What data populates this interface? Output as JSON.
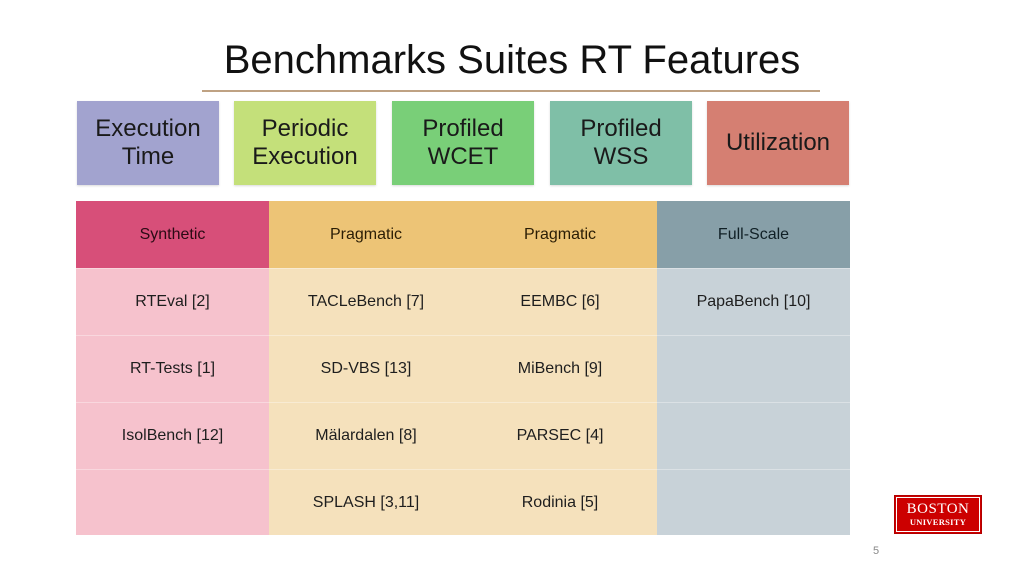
{
  "slide": {
    "title": "Benchmarks Suites RT Features",
    "page_number": "5"
  },
  "features": [
    {
      "label": "Execution Time",
      "color": "#a2a3cf"
    },
    {
      "label": "Periodic Execution",
      "color": "#c4e07a"
    },
    {
      "label": "Profiled WCET",
      "color": "#79cf78"
    },
    {
      "label": "Profiled WSS",
      "color": "#7fbfa7"
    },
    {
      "label": "Utilization",
      "color": "#d57f72"
    }
  ],
  "table": {
    "headers": [
      "Synthetic",
      "Pragmatic",
      "Pragmatic",
      "Full-Scale"
    ],
    "rows": [
      [
        "RTEval [2]",
        "TACLeBench [7]",
        "EEMBC [6]",
        "PapaBench [10]"
      ],
      [
        "RT-Tests [1]",
        "SD-VBS [13]",
        "MiBench [9]",
        ""
      ],
      [
        "IsolBench [12]",
        "Mälardalen [8]",
        "PARSEC [4]",
        ""
      ],
      [
        "",
        "SPLASH [3,11]",
        "Rodinia [5]",
        ""
      ]
    ],
    "colors": {
      "synthetic_header": "#d74f79",
      "pragmatic_header": "#edc476",
      "fullscale_header": "#879fa8",
      "synthetic_cell": "#f6c2cd",
      "pragmatic_cell": "#f5e1bc",
      "fullscale_cell": "#c8d2d8"
    }
  },
  "logo": {
    "line1": "BOSTON",
    "line2": "UNIVERSITY",
    "color": "#cc0000"
  }
}
